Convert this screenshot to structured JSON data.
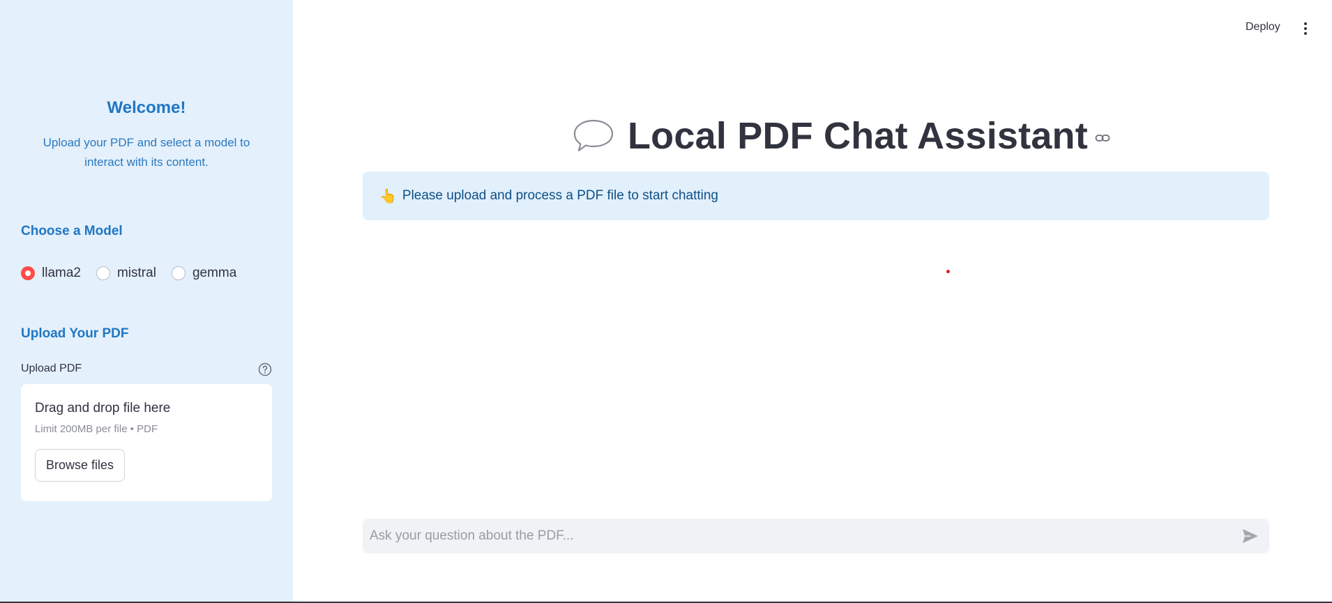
{
  "sidebar": {
    "welcome_title": "Welcome!",
    "welcome_subtitle": "Upload your PDF and select a model to interact with its content.",
    "model_heading": "Choose a Model",
    "models": [
      {
        "label": "llama2",
        "selected": true
      },
      {
        "label": "mistral",
        "selected": false
      },
      {
        "label": "gemma",
        "selected": false
      }
    ],
    "upload_heading": "Upload Your PDF",
    "upload_label": "Upload PDF",
    "dropzone_title": "Drag and drop file here",
    "dropzone_limit": "Limit 200MB per file • PDF",
    "browse_label": "Browse files"
  },
  "header": {
    "deploy_label": "Deploy",
    "menu_icon": "kebab-menu-icon"
  },
  "main": {
    "title_icon": "speech-bubble-icon",
    "title": "Local PDF Chat Assistant",
    "info_emoji": "👆",
    "info_text": "Please upload and process a PDF file to start chatting",
    "chat_placeholder": "Ask your question about the PDF..."
  },
  "colors": {
    "sidebar_bg": "#e4f0fb",
    "accent_blue": "#1f77c4",
    "radio_selected": "#ff4b4b",
    "info_bg": "#e2f0fc",
    "info_text": "#0d4f85",
    "input_bg": "#f0f2f6"
  }
}
